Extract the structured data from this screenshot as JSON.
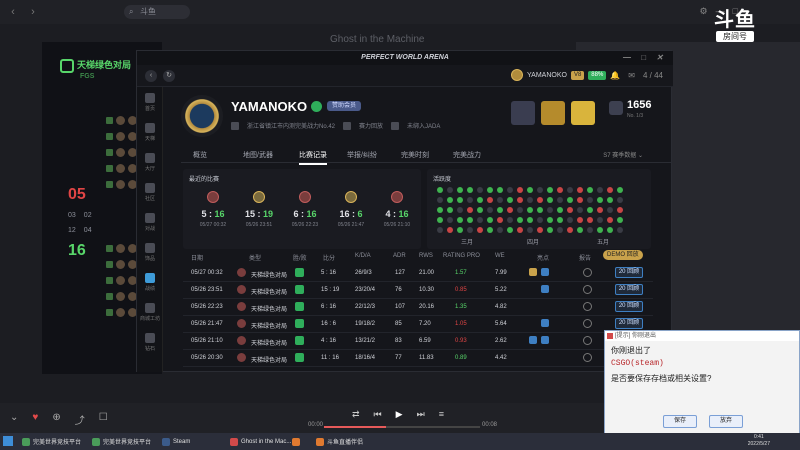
{
  "browser": {
    "search_placeholder": "斗鱼",
    "stream_title": "Ghost in the Machine"
  },
  "watermark": {
    "logo": "斗鱼",
    "label": "房间号",
    "room_number": "10772798"
  },
  "bg_app": {
    "brand": "天梯绿色对局",
    "brand_sub": "FGS",
    "score_red": "05",
    "score_green": "16",
    "small_a": [
      "03",
      "02"
    ],
    "small_b": [
      "12",
      "04"
    ]
  },
  "arena": {
    "title": "PERFECT WORLD ARENA",
    "username_header": "YAMANOKO",
    "vip_tag": "V8",
    "nav_tag": "88%",
    "friends_count": "4 / 44",
    "sidebar": [
      "首页",
      "天梯",
      "大厅",
      "社区",
      "对战",
      "饰品",
      "商城",
      "战绩",
      "商城工坊",
      "钻石"
    ],
    "profile": {
      "name": "YAMANOKO",
      "vip_label": "赞助会员",
      "location": "浙江省镇江市内测完美战力No.42",
      "note1": "赛力回放",
      "note2": "未绑入JADA",
      "elo": "1656",
      "elo_sub": "No. 1/3"
    },
    "tabs": [
      "概览",
      "地图/武器",
      "比赛记录",
      "举报/纠纷",
      "完美时刻",
      "完美战力"
    ],
    "active_tab": "比赛记录",
    "season": "S7 赛季数据",
    "recent": {
      "title": "最近的比赛",
      "matches": [
        {
          "left": "5",
          "right": "16",
          "date": "05/27 00:32",
          "win": true
        },
        {
          "left": "15",
          "right": "19",
          "date": "05/26 23:51",
          "win": false
        },
        {
          "left": "6",
          "right": "16",
          "date": "05/26 22:23",
          "win": true
        },
        {
          "left": "16",
          "right": "6",
          "date": "05/26 21:47",
          "win": false
        },
        {
          "left": "4",
          "right": "16",
          "date": "05/26 21:10",
          "win": true
        }
      ]
    },
    "activity": {
      "title": "活跃度",
      "months": [
        "三月",
        "四月",
        "五月"
      ]
    },
    "table": {
      "headers": [
        "日期",
        "类型",
        "胜/败",
        "比分",
        "K/D/A",
        "ADR",
        "RWS",
        "RATING PRO",
        "WE",
        "亮点",
        "报告"
      ],
      "demo_label": "DEMO 回放",
      "rows": [
        {
          "date": "05/27 00:32",
          "type": "天梯绿色对局",
          "score": "5 : 16",
          "kda": "26/9/3",
          "adr": "127",
          "rws": "21.00",
          "rating": "1.57",
          "rating_good": true,
          "we": "7.99",
          "action": "20 回顾"
        },
        {
          "date": "05/26 23:51",
          "type": "天梯绿色对局",
          "score": "15 : 19",
          "kda": "23/20/4",
          "adr": "76",
          "rws": "10.30",
          "rating": "0.85",
          "rating_good": false,
          "we": "5.22",
          "action": "20 回顾"
        },
        {
          "date": "05/26 22:23",
          "type": "天梯绿色对局",
          "score": "6 : 16",
          "kda": "22/12/3",
          "adr": "107",
          "rws": "20.16",
          "rating": "1.35",
          "rating_good": true,
          "we": "4.82",
          "action": "20 回顾"
        },
        {
          "date": "05/26 21:47",
          "type": "天梯绿色对局",
          "score": "16 : 6",
          "kda": "19/18/2",
          "adr": "85",
          "rws": "7.20",
          "rating": "1.05",
          "rating_good": false,
          "we": "5.64",
          "action": "20 回顾"
        },
        {
          "date": "05/26 21:10",
          "type": "天梯绿色对局",
          "score": "4 : 16",
          "kda": "13/21/2",
          "adr": "83",
          "rws": "6.59",
          "rating": "0.93",
          "rating_good": false,
          "we": "2.62",
          "action": "20 回顾"
        },
        {
          "date": "05/26 20:30",
          "type": "天梯绿色对局",
          "score": "11 : 16",
          "kda": "18/16/4",
          "adr": "77",
          "rws": "11.83",
          "rating": "0.89",
          "rating_good": true,
          "we": "4.42",
          "action": "20 回顾"
        }
      ]
    }
  },
  "player": {
    "time_current": "00:00",
    "time_total": "00:08",
    "progress": 0.4
  },
  "dialog": {
    "title": "[提示] 你刚退出",
    "line1": "你刚退出了",
    "line2": "CSGO(steam)",
    "line3": "是否要保存存档或相关设置?",
    "save": "保存",
    "cancel": "放弃"
  },
  "taskbar": {
    "items": [
      "完美世界竞技平台",
      "完美世界竞技平台",
      "Steam",
      "Ghost in the Mac...",
      "斗鱼直播伴侣"
    ],
    "time": "0:41",
    "date": "2022/5/27"
  }
}
